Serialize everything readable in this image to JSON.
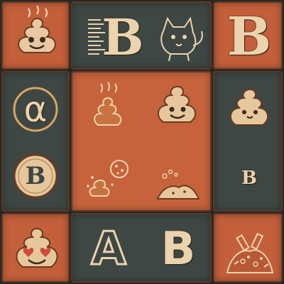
{
  "tiles": {
    "top_row_letter_b_center": "B",
    "top_row_letter_b_right": "B",
    "left_alpha": "α",
    "left_coin_b": "B",
    "right_small_b": "B",
    "bottom_letter_a": "A",
    "bottom_letter_b": "B"
  },
  "palette": {
    "orange": "#c35f3a",
    "slate": "#3e4744",
    "cream": "#ead3ad",
    "outline": "#5a3a2a"
  },
  "icons": [
    "poop-emoji-icon",
    "barcode-b-icon",
    "cat-icon",
    "alpha-coin-icon",
    "steaming-poop-icon",
    "smiling-poop-icon",
    "kawaii-poop-icon",
    "coin-b-icon",
    "poop-with-cookie-icon",
    "dirt-pile-icon",
    "heart-eyes-poop-icon",
    "trash-pile-icon"
  ]
}
